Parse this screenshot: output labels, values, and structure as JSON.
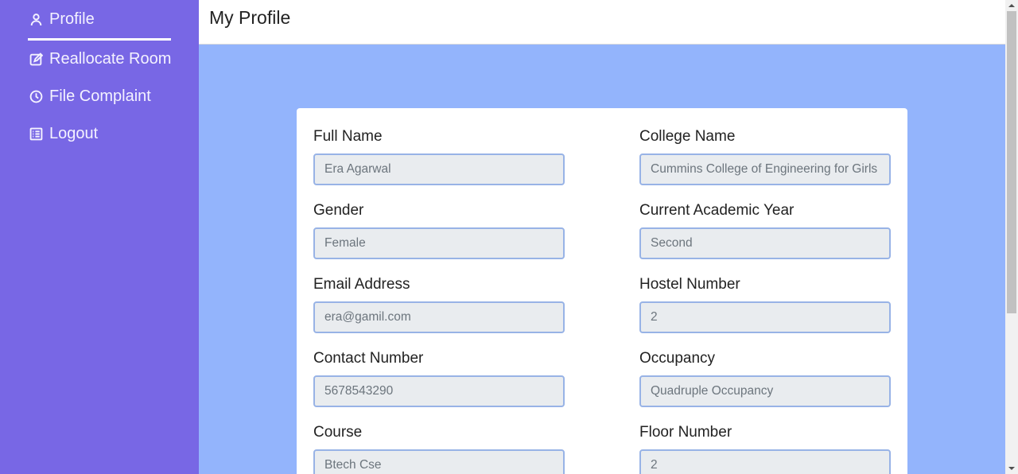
{
  "sidebar": {
    "items": [
      {
        "label": "Profile",
        "icon": "user-icon"
      },
      {
        "label": "Reallocate Room",
        "icon": "edit-icon"
      },
      {
        "label": "File Complaint",
        "icon": "clock-icon"
      },
      {
        "label": "Logout",
        "icon": "list-icon"
      }
    ],
    "active": "Profile"
  },
  "header": {
    "title": "My Profile"
  },
  "form": {
    "full_name": {
      "label": "Full Name",
      "value": "Era Agarwal"
    },
    "college_name": {
      "label": "College Name",
      "value": "Cummins College of Engineering for Girls"
    },
    "gender": {
      "label": "Gender",
      "value": "Female"
    },
    "academic_year": {
      "label": "Current Academic Year",
      "value": "Second"
    },
    "email": {
      "label": "Email Address",
      "value": "era@gamil.com"
    },
    "hostel_number": {
      "label": "Hostel Number",
      "value": "2"
    },
    "contact_number": {
      "label": "Contact Number",
      "value": "5678543290"
    },
    "occupancy": {
      "label": "Occupancy",
      "value": "Quadruple Occupancy"
    },
    "course": {
      "label": "Course",
      "value": "Btech Cse"
    },
    "floor_number": {
      "label": "Floor Number",
      "value": "2"
    }
  },
  "colors": {
    "sidebar_bg": "#7867e5",
    "main_bg": "#93b4fc",
    "input_border": "#98b3e6",
    "input_bg": "#e9ecef"
  }
}
